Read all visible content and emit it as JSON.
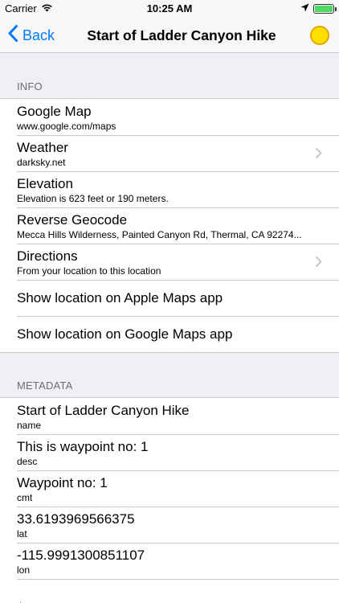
{
  "status_bar": {
    "carrier": "Carrier",
    "time": "10:25 AM",
    "battery_level": 1.0
  },
  "nav": {
    "back_label": "Back",
    "title": "Start of Ladder Canyon Hike"
  },
  "info": {
    "header": "INFO",
    "rows": [
      {
        "title": "Google Map",
        "subtitle": "www.google.com/maps"
      },
      {
        "title": "Weather",
        "subtitle": "darksky.net"
      },
      {
        "title": "Elevation",
        "subtitle": "Elevation is 623 feet or 190 meters."
      },
      {
        "title": "Reverse Geocode",
        "subtitle": "Mecca Hills Wilderness, Painted Canyon Rd, Thermal, CA  92274..."
      },
      {
        "title": "Directions",
        "subtitle": "From your location to this location"
      },
      {
        "title": "Show location on Apple Maps app"
      },
      {
        "title": "Show location on Google Maps app"
      }
    ]
  },
  "metadata": {
    "header": "METADATA",
    "rows": [
      {
        "title": "Start of Ladder Canyon Hike",
        "subtitle": "name"
      },
      {
        "title": "This is waypoint no: 1",
        "subtitle": "desc"
      },
      {
        "title": "Waypoint no: 1",
        "subtitle": "cmt"
      },
      {
        "title": "33.6193969566375",
        "subtitle": "lat"
      },
      {
        "title": "-115.9991300851107",
        "subtitle": "lon"
      },
      {
        "title": "",
        "subtitle": "time"
      }
    ]
  },
  "icons": {
    "wifi": "wifi-icon",
    "location_arrow": "location-arrow-icon",
    "battery": "battery-icon",
    "back_chevron": "chevron-left-icon",
    "sun": "sun-icon",
    "row_chevron": "chevron-right-icon"
  },
  "colors": {
    "accent": "#007aff",
    "background": "#efeff4",
    "sun_fill": "#ffe100",
    "battery_fill": "#4cd964"
  }
}
